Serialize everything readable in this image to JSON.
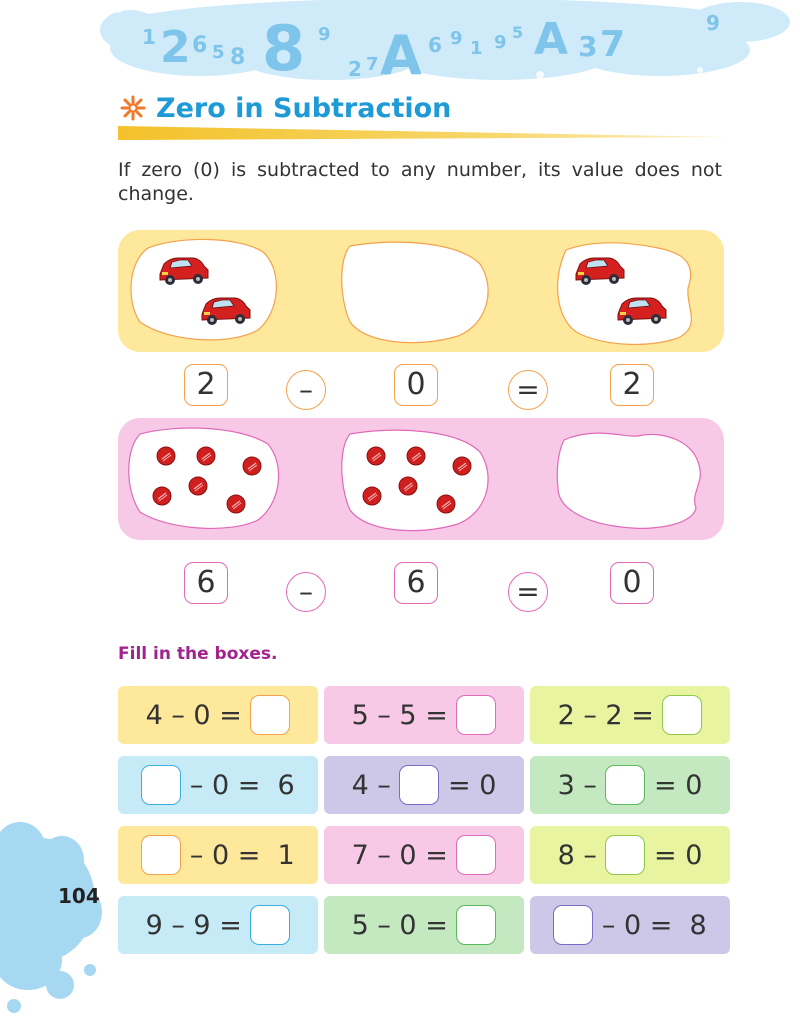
{
  "header": {
    "banner_digits": [
      "1",
      "2",
      "6",
      "5",
      "8",
      "8",
      "9",
      "2",
      "7",
      "A",
      "6",
      "9",
      "1",
      "9",
      "5",
      "A",
      "3",
      "7",
      "9"
    ]
  },
  "section": {
    "title": "Zero in Subtraction",
    "intro": "If zero (0) is subtracted to any number, its value does not change."
  },
  "examples": [
    {
      "panel_color": "#fde89b",
      "object": "red-car-icon",
      "counts": [
        2,
        0,
        2
      ],
      "expression": {
        "a": "2",
        "op": "–",
        "b": "0",
        "eq": "=",
        "result": "2"
      }
    },
    {
      "panel_color": "#f8c9e7",
      "object": "red-ball-icon",
      "counts": [
        6,
        6,
        0
      ],
      "expression": {
        "a": "6",
        "op": "–",
        "b": "6",
        "eq": "=",
        "result": "0"
      }
    }
  ],
  "exercise": {
    "heading": "Fill in the boxes.",
    "rows": [
      [
        {
          "parts": [
            "4 – 0 = ",
            "[]"
          ],
          "color": "#fde89b"
        },
        {
          "parts": [
            "5 – 5 = ",
            "[]"
          ],
          "color": "#f8c9e7"
        },
        {
          "parts": [
            "2 – 2 = ",
            "[]"
          ],
          "color": "#e9f4a0"
        }
      ],
      [
        {
          "parts": [
            "[]",
            " – 0 =  6"
          ],
          "color": "#c6ebf7"
        },
        {
          "parts": [
            "4 – ",
            "[]",
            " = 0"
          ],
          "color": "#cdc8e8"
        },
        {
          "parts": [
            "3 – ",
            "[]",
            " = 0"
          ],
          "color": "#c4e8c0"
        }
      ],
      [
        {
          "parts": [
            "[]",
            " – 0 =  1"
          ],
          "color": "#fde89b"
        },
        {
          "parts": [
            "7 – 0 = ",
            "[]"
          ],
          "color": "#f8c9e7"
        },
        {
          "parts": [
            "8 – ",
            "[]",
            " = 0"
          ],
          "color": "#e9f4a0"
        }
      ],
      [
        {
          "parts": [
            "9 – 9 = ",
            "[]"
          ],
          "color": "#c6ebf7"
        },
        {
          "parts": [
            "5 – 0 = ",
            "[]"
          ],
          "color": "#c4e8c0"
        },
        {
          "parts": [
            "[]",
            " – 0 =  8"
          ],
          "color": "#cdc8e8"
        }
      ]
    ]
  },
  "footer": {
    "page_number": "104"
  },
  "colors": {
    "title_blue": "#1e9ad6",
    "heading_purple": "#a3238e",
    "accent_orange": "#f4a24b",
    "accent_pink": "#e06ab8",
    "splash_blue": "#c3e4f7"
  }
}
